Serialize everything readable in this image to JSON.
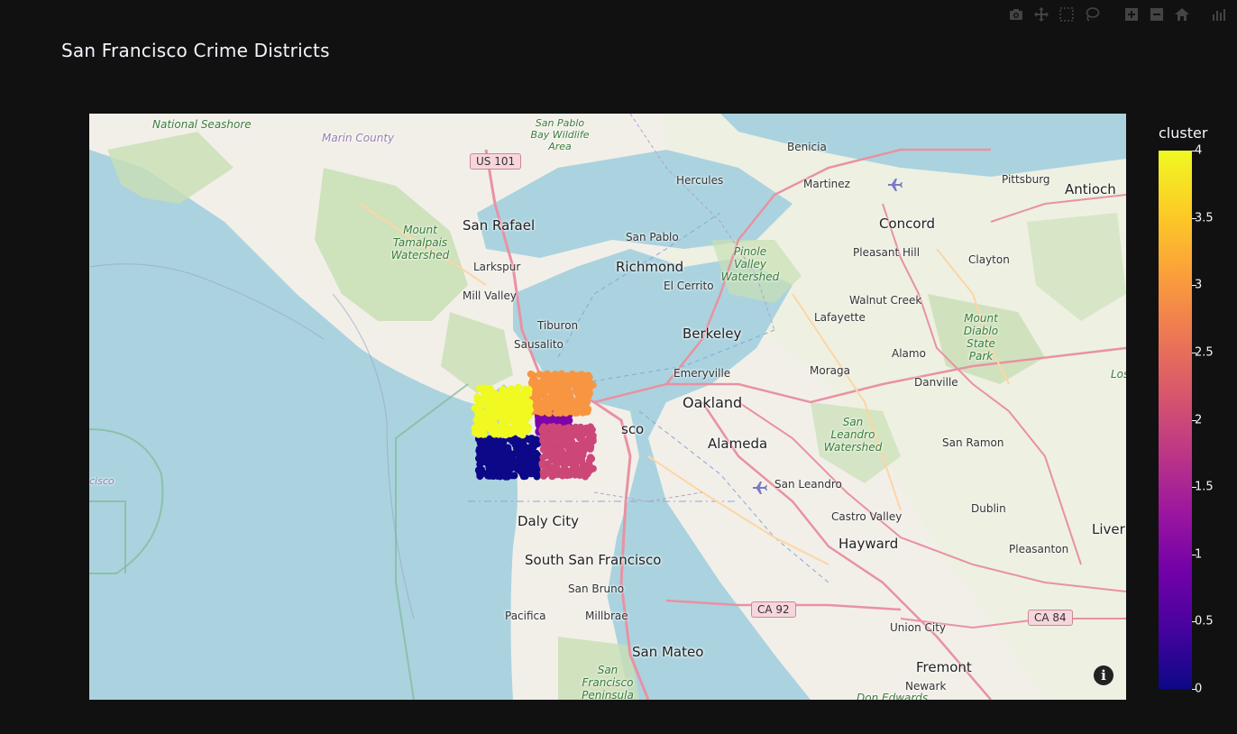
{
  "modebar": [
    {
      "icon": "camera-icon"
    },
    {
      "icon": "pan-icon"
    },
    {
      "icon": "box-select-icon"
    },
    {
      "icon": "lasso-select-icon"
    },
    {
      "icon": "zoom-in-icon"
    },
    {
      "icon": "zoom-out-icon"
    },
    {
      "icon": "home-icon"
    },
    {
      "icon": "plotly-logo-icon"
    }
  ],
  "chart_data": {
    "type": "scatter",
    "title": "San Francisco Crime Districts",
    "map_style": "open-street-map",
    "color_variable": "cluster",
    "colorscale": [
      "#0d0887",
      "#46039f",
      "#7201a8",
      "#9c179e",
      "#bd3786",
      "#d8576b",
      "#ed7953",
      "#fb9f3a",
      "#fdca26",
      "#f0f921"
    ],
    "colorbar": {
      "title": "cluster",
      "range": [
        0,
        4
      ],
      "ticks": [
        "4",
        "3.5",
        "3",
        "2.5",
        "2",
        "1.5",
        "1",
        "0.5",
        "0"
      ]
    },
    "clusters": [
      {
        "cluster": 0,
        "lat_range": [
          37.708,
          37.753
        ],
        "lon_range": [
          -122.51,
          -122.435
        ],
        "color": "#0d0887"
      },
      {
        "cluster": 1,
        "lat_range": [
          37.755,
          37.79
        ],
        "lon_range": [
          -122.435,
          -122.395
        ],
        "color": "#7e03a8"
      },
      {
        "cluster": 2,
        "lat_range": [
          37.708,
          37.765
        ],
        "lon_range": [
          -122.43,
          -122.365
        ],
        "color": "#cc4778"
      },
      {
        "cluster": 3,
        "lat_range": [
          37.78,
          37.825
        ],
        "lon_range": [
          -122.445,
          -122.37
        ],
        "color": "#f89540"
      },
      {
        "cluster": 4,
        "lat_range": [
          37.755,
          37.81
        ],
        "lon_range": [
          -122.515,
          -122.445
        ],
        "color": "#f0f921"
      }
    ]
  },
  "map_labels": {
    "national_seashore": "National Seashore",
    "marin_county": "Marin County",
    "san_pablo_bay": "San Pablo Bay Wildlife Area",
    "us101": "US 101",
    "benicia": "Benicia",
    "hercules": "Hercules",
    "martinez": "Martinez",
    "pittsburg": "Pittsburg",
    "antioch": "Antioch",
    "san_rafael": "San Rafael",
    "mount_tamalpais": "Mount Tamalpais Watershed",
    "san_pablo": "San Pablo",
    "concord": "Concord",
    "pinole_valley": "Pinole Valley Watershed",
    "pleasant_hill": "Pleasant Hill",
    "larkspur": "Larkspur",
    "richmond": "Richmond",
    "clayton": "Clayton",
    "mill_valley": "Mill Valley",
    "el_cerrito": "El Cerrito",
    "walnut_creek": "Walnut Creek",
    "tiburon": "Tiburon",
    "lafayette": "Lafayette",
    "mount_diablo": "Mount Diablo State Park",
    "sausalito": "Sausalito",
    "berkeley": "Berkeley",
    "alamo": "Alamo",
    "moraga": "Moraga",
    "emeryville": "Emeryville",
    "danville": "Danville",
    "oakland": "Oakland",
    "san_francisco_part": "sco",
    "alameda": "Alameda",
    "san_leandro_watershed": "San Leandro Watershed",
    "san_ramon": "San Ramon",
    "cisco": "cisco",
    "san_leandro": "San Leandro",
    "daly_city": "Daly City",
    "castro_valley": "Castro Valley",
    "dublin": "Dublin",
    "hayward": "Hayward",
    "livermore": "Liver",
    "south_san_francisco": "South San Francisco",
    "pleasanton": "Pleasanton",
    "san_bruno": "San Bruno",
    "ca92": "CA 92",
    "pacifica": "Pacifica",
    "millbrae": "Millbrae",
    "union_city": "Union City",
    "ca84": "CA 84",
    "san_mateo": "San Mateo",
    "fremont": "Fremont",
    "sf_peninsula": "San Francisco Peninsula Watershed",
    "newark": "Newark",
    "don_edwards": "Don Edwards",
    "los": "Los"
  },
  "info_glyph": "i"
}
